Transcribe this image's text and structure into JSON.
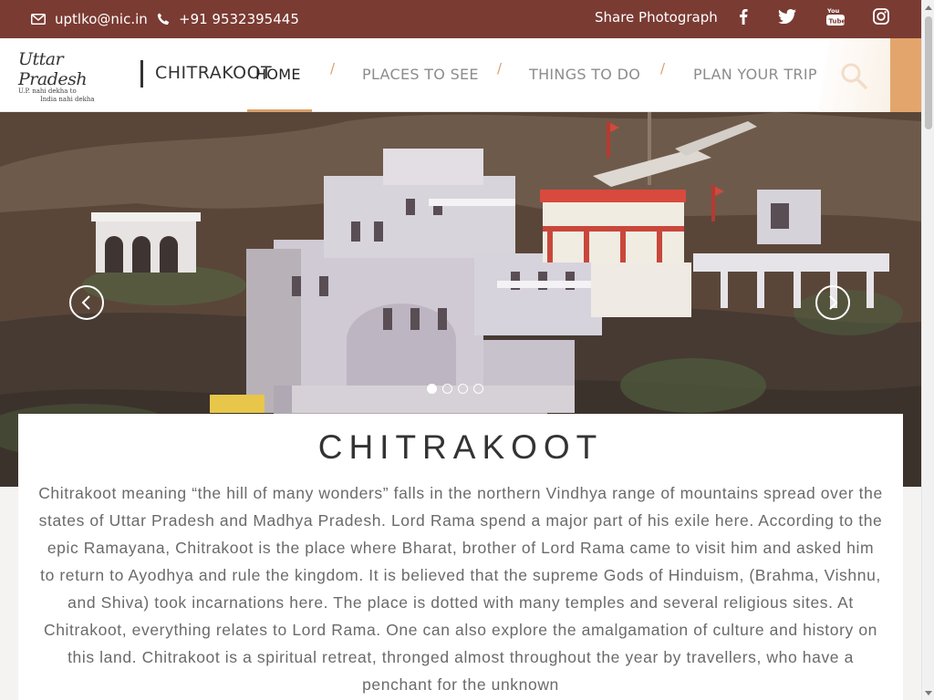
{
  "topbar": {
    "email": "uptlko@nic.in",
    "phone": "+91 9532395445",
    "share": "Share Photograph",
    "social": [
      "facebook-icon",
      "twitter-icon",
      "youtube-icon",
      "instagram-icon"
    ]
  },
  "header": {
    "logo": {
      "script": "Uttar Pradesh",
      "tagline1": "U.P. nahi dekha to",
      "tagline2": "India nahi dekha"
    },
    "site_name": "CHITRAKOOT",
    "nav": [
      {
        "label": "HOME",
        "active": true
      },
      {
        "label": "PLACES TO SEE",
        "active": false
      },
      {
        "label": "THINGS TO DO",
        "active": false
      },
      {
        "label": "PLAN YOUR TRIP",
        "active": false
      }
    ],
    "separator": "/"
  },
  "hero": {
    "slide_count": 4,
    "active_slide": 1
  },
  "main": {
    "title": "CHITRAKOOT",
    "description": "Chitrakoot meaning “the hill of many wonders” falls in the northern Vindhya range of mountains spread over the states of Uttar Pradesh and Madhya Pradesh. Lord Rama spend a major part of his exile here. According to the epic Ramayana, Chitrakoot is the place where Bharat, brother of Lord Rama came to visit him and asked him to return to Ayodhya and rule the kingdom. It is believed that the supreme Gods of Hinduism, (Brahma, Vishnu, and Shiva) took incarnations here. The place is dotted with many temples and several religious sites. At Chitrakoot, everything relates to Lord Rama. One can also explore the amalgamation of culture and history on this land. Chitrakoot is a spiritual retreat, thronged almost throughout the year by travellers, who have a penchant for the unknown"
  },
  "colors": {
    "topbar": "#7a3b33",
    "accent": "#e3a56c",
    "text": "#6a6a6a"
  }
}
